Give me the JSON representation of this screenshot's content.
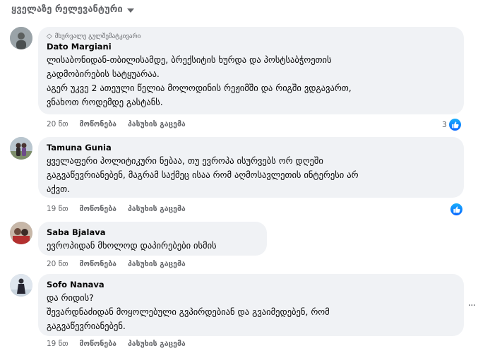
{
  "sort_label": "ყველაზე რელევანტური",
  "colors": {
    "like_blue": "#0866ff",
    "bubble_bg": "#f0f2f5",
    "muted_text": "#65676b"
  },
  "comments": [
    {
      "badge": "მხურვალე გულშემატკივარი",
      "author": "Dato Margiani",
      "text": "ლისაბონიდან-თბილისამდე, ბრექსიტის ხურდა და პოსტსაბჭოეთის\nგადმობირების სატყუარაა.\nაგერ უკვე 2 ათეული წელია მოლოდინის რეჟიმში და რიგში ვდგავართ,\nვნახოთ როდემდე გასტანს.",
      "time": "20 წთ",
      "like_label": "მოწონება",
      "reply_label": "პასუხის გაცემა",
      "reaction_count": "3",
      "reaction_icon": "like-icon"
    },
    {
      "author": "Tamuna Gunia",
      "text": "ყველაფერი პოლიტიკური ნებაა, თუ ევროპა ისურვებს ორ დღეში\nგაგვაწევრიანებენ, მაგრამ საქმეც ისაა რომ აღმოსავლეთის ინტერესი არ\nაქვთ.",
      "time": "19 წთ",
      "like_label": "მოწონება",
      "reply_label": "პასუხის გაცემა",
      "reaction_icon": "like-icon"
    },
    {
      "author": "Saba Bjalava",
      "text": "ევროპიდან მხოლოდ დაპირებები ისმის",
      "time": "20 წთ",
      "like_label": "მოწონება",
      "reply_label": "პასუხის გაცემა"
    },
    {
      "author": "Sofo Nanava",
      "text": "და რიდის?\nშევარდნაძიდან მოყოლებული გვპირდებიან და გვაიმედებენ, რომ\nგაგვაწევრიანებენ.",
      "time": "19 წთ",
      "like_label": "მოწონება",
      "reply_label": "პასუხის გაცემა"
    }
  ]
}
